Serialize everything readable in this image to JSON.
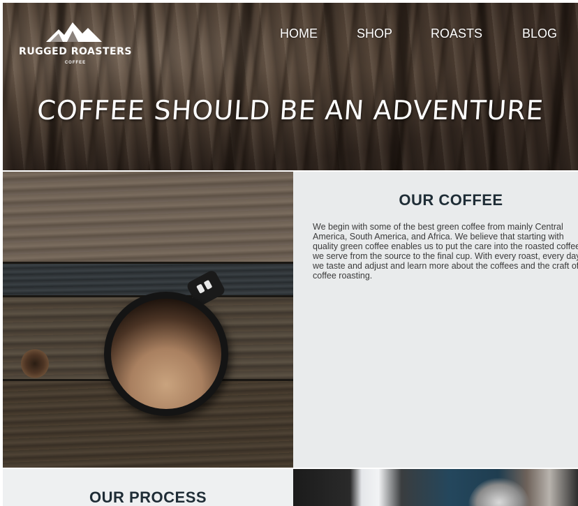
{
  "header": {
    "logo": {
      "name": "RUGGED ROASTERS",
      "subtitle": "COFFEE",
      "icon": "mountain-icon"
    },
    "nav": [
      {
        "label": "HOME"
      },
      {
        "label": "SHOP"
      },
      {
        "label": "ROASTS"
      },
      {
        "label": "BLOG"
      }
    ],
    "tagline": "COFFEE SHOULD BE AN ADVENTURE"
  },
  "our_coffee": {
    "heading": "OUR COFFEE",
    "body": "We begin with some of the best green coffee from mainly Central America, South America, and Africa. We believe that starting with quality green coffee enables us to put the care into the roasted coffee we serve from the source to the final cup. With every roast, every day, we taste and adjust and learn more about the coffees and the craft of coffee roasting."
  },
  "our_process": {
    "heading": "OUR PROCESS"
  },
  "colors": {
    "heading": "#1f2d36",
    "panel_bg": "#e9ebec",
    "nav_text": "#ffffff"
  }
}
